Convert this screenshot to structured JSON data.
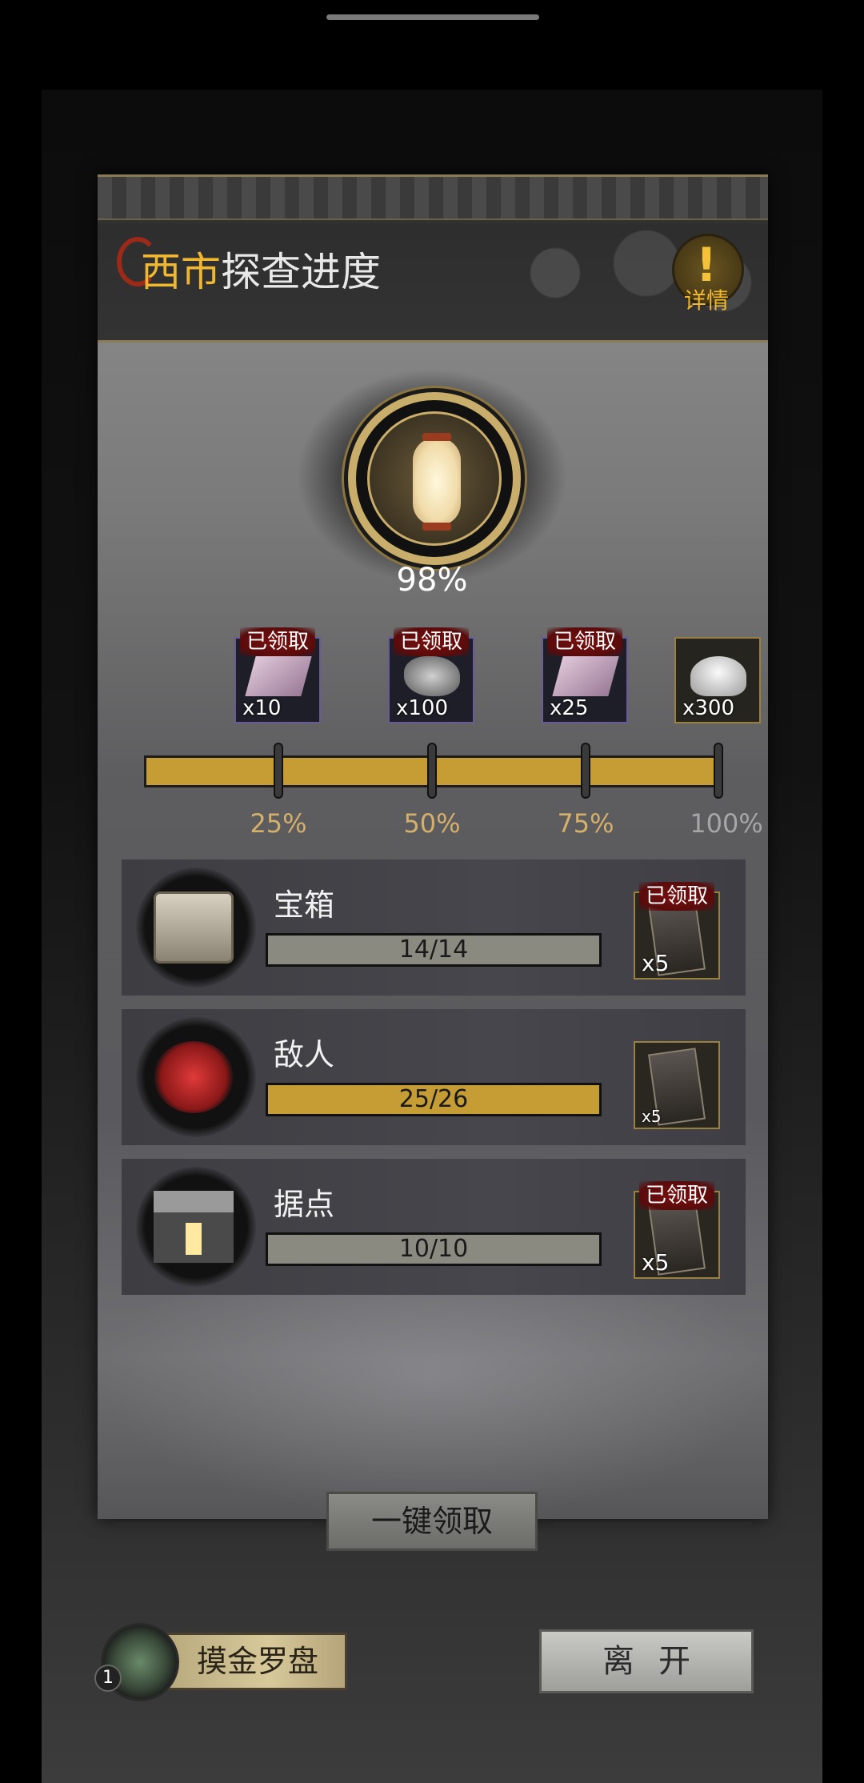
{
  "header": {
    "title_highlight": "西市",
    "title_rest": "探查进度",
    "detail_label": "详情"
  },
  "overall_progress": {
    "percent_text": "98%",
    "value": 0.98
  },
  "milestone_rewards": [
    {
      "qty": "x10",
      "claimed_label": "已领取",
      "claimed": true,
      "icon": "purple-ingot-icon"
    },
    {
      "qty": "x100",
      "claimed_label": "已领取",
      "claimed": true,
      "icon": "ore-chunk-icon"
    },
    {
      "qty": "x25",
      "claimed_label": "已领取",
      "claimed": true,
      "icon": "purple-ingot-icon"
    },
    {
      "qty": "x300",
      "claimed": false,
      "icon": "silver-ingot-icon"
    }
  ],
  "milestones": [
    "25%",
    "50%",
    "75%",
    "100%"
  ],
  "tasks": [
    {
      "name": "宝箱",
      "progress_text": "14/14",
      "progress": 1.0,
      "reward_qty": "x5",
      "claimed_label": "已领取",
      "claimed": true,
      "icon": "treasure-chest-icon"
    },
    {
      "name": "敌人",
      "progress_text": "25/26",
      "progress": 0.9615,
      "reward_qty": "x5",
      "claimed": false,
      "icon": "enemy-skull-icon"
    },
    {
      "name": "据点",
      "progress_text": "10/10",
      "progress": 1.0,
      "reward_qty": "x5",
      "claimed_label": "已领取",
      "claimed": true,
      "icon": "stronghold-icon"
    }
  ],
  "buttons": {
    "claim_all": "一键领取",
    "compass": "摸金罗盘",
    "compass_badge": "1",
    "leave": "离开"
  },
  "colors": {
    "accent_gold": "#f0b731",
    "progress_fill": "#c69c35",
    "claimed_red": "#7a1010"
  }
}
